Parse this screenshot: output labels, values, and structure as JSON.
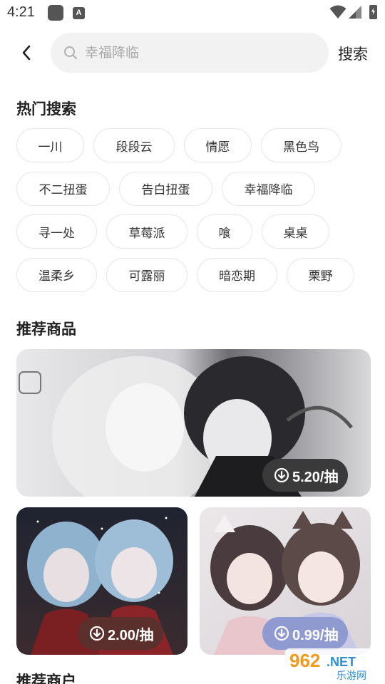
{
  "status_bar": {
    "time": "4:21",
    "a_icon_letter": "A",
    "icons": [
      "app-icon",
      "a-icon",
      "wifi-icon",
      "signal-icon",
      "battery-icon"
    ]
  },
  "header": {
    "back_icon": "chevron-left-icon",
    "search": {
      "value": "",
      "placeholder": "幸福降临",
      "icon": "search-icon"
    },
    "search_button_label": "搜索"
  },
  "hot_search": {
    "title": "热门搜索",
    "rows": [
      [
        "一川",
        "段段云",
        "情愿",
        "黑色鸟"
      ],
      [
        "不二扭蛋",
        "告白扭蛋",
        "幸福降临"
      ],
      [
        "寻一处",
        "草莓派",
        "喰",
        "桌桌"
      ],
      [
        "温柔乡",
        "可露丽",
        "暗恋期",
        "栗野"
      ]
    ]
  },
  "recommended_products": {
    "title": "推荐商品",
    "items": [
      {
        "price": "5.20/抽",
        "badge_color": "#3a3a3a"
      },
      {
        "price": "2.00/抽",
        "badge_color": "#5a2f2c"
      },
      {
        "price": "0.99/抽",
        "badge_color": "#8f9ad0"
      }
    ]
  },
  "next_section": {
    "title": "推荐商户"
  },
  "watermark": {
    "brand_number": "962",
    "brand_suffix": ".NET",
    "brand_subtitle": "乐游网"
  },
  "colors": {
    "search_bg": "#f2f2f2",
    "tag_border": "#e6e6e6",
    "text": "#222222"
  }
}
